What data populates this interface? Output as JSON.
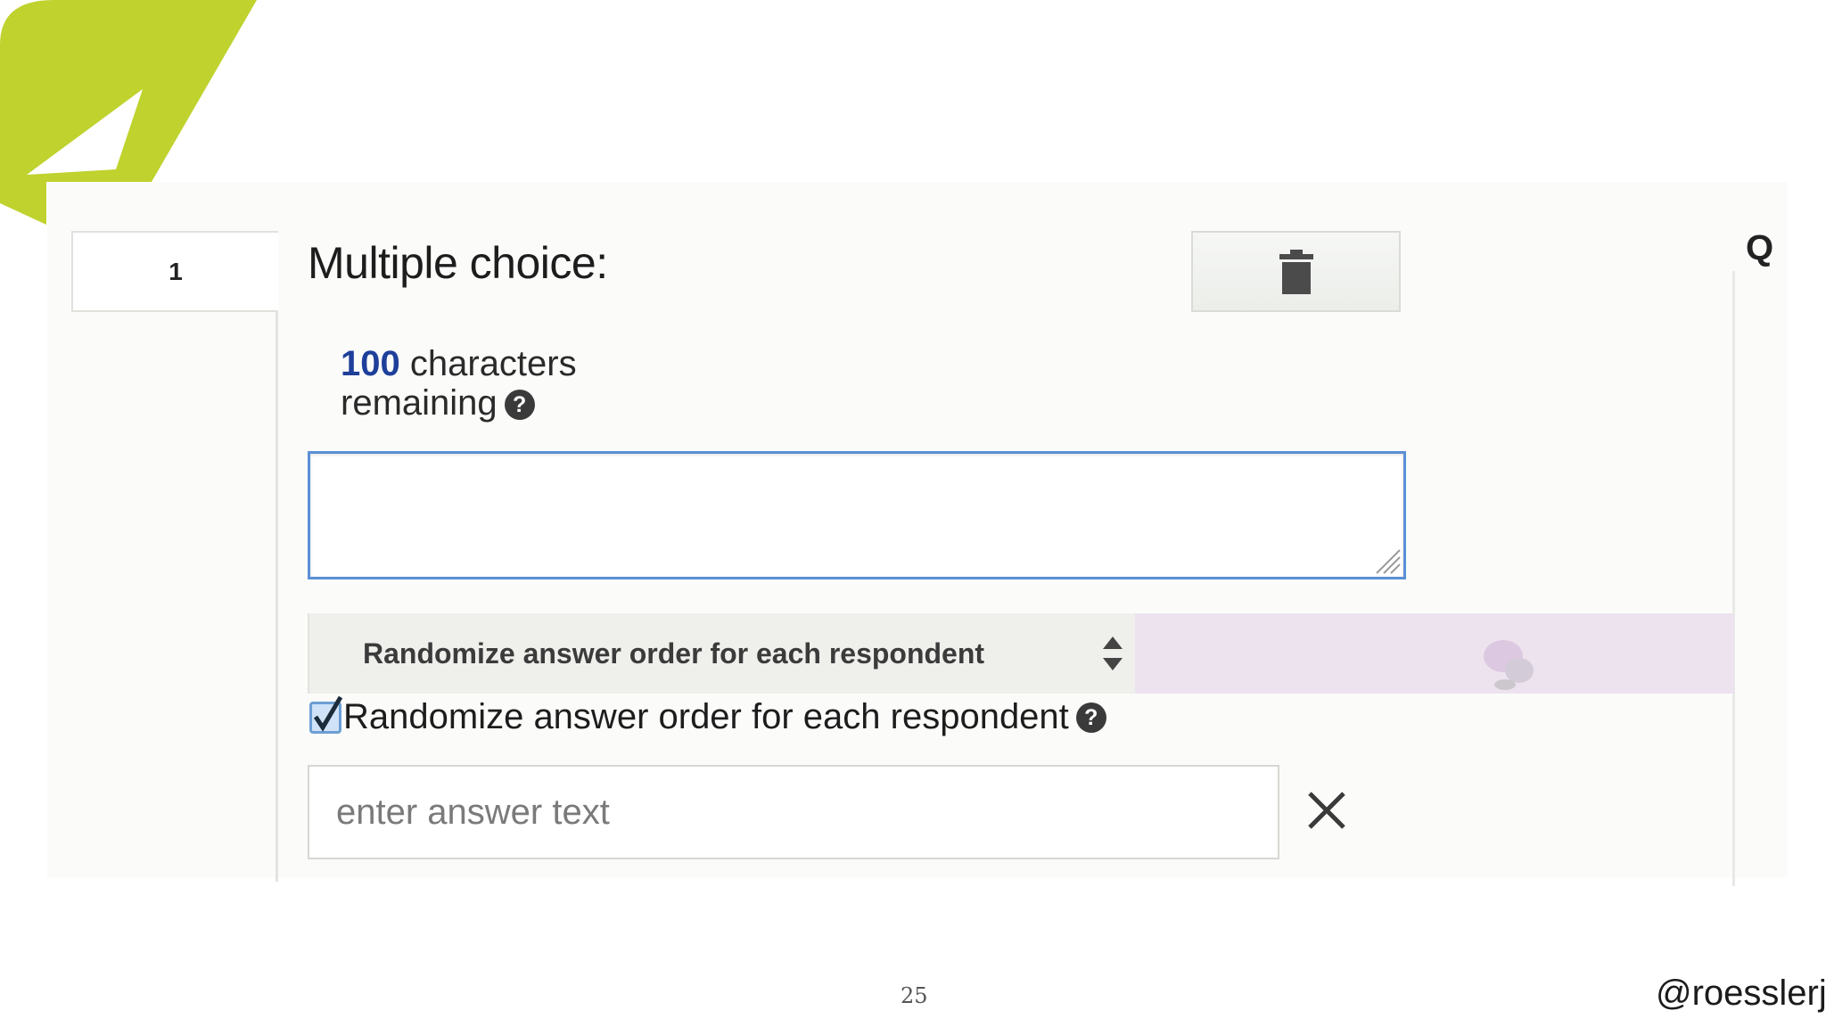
{
  "colors": {
    "accent_leaf": "#bfd22e",
    "counter_number": "#1e3f9a",
    "input_focus_border": "#5b8fd6",
    "option_band": "#ede3ef"
  },
  "question": {
    "number": "1",
    "type_title": "Multiple choice:",
    "delete_icon": "trash-icon",
    "partial_right_label": "Q"
  },
  "counter": {
    "count": "100",
    "text_line1": "characters",
    "text_line2": "remaining",
    "help_glyph": "?"
  },
  "question_input": {
    "value": ""
  },
  "randomize_select": {
    "selected_label": "Randomize answer order for each respondent"
  },
  "randomize_checkbox": {
    "checked": true,
    "label": "Randomize answer order for each respondent",
    "help_glyph": "?"
  },
  "answer_input": {
    "placeholder": "enter answer text",
    "value": "",
    "remove_icon": "close-icon"
  },
  "footer": {
    "page_number": "25",
    "handle": "@roesslerj"
  }
}
